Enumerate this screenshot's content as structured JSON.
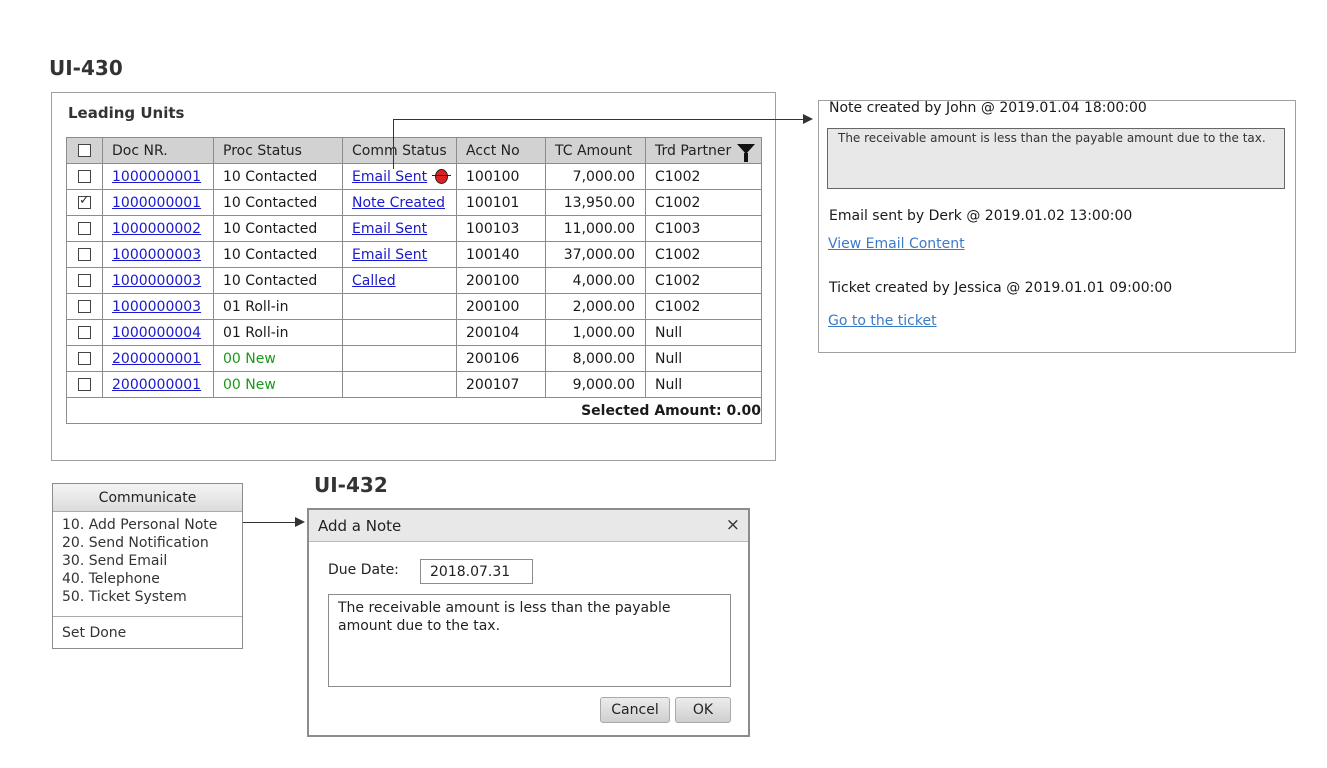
{
  "ui430": {
    "id_label": "UI-430",
    "panel_title": "Leading Units"
  },
  "table": {
    "headers": [
      "Doc NR.",
      "Proc Status",
      "Comm Status",
      "Acct No",
      "TC Amount",
      "Trd Partner"
    ],
    "rows": [
      {
        "checked": false,
        "doc": "1000000001",
        "proc": "10 Contacted",
        "comm": "Email Sent",
        "acct": "100100",
        "amount": "7,000.00",
        "partner": "C1002",
        "proc_color": "#1a1a1a",
        "flag": "bug-icon"
      },
      {
        "checked": true,
        "doc": "1000000001",
        "proc": "10 Contacted",
        "comm": "Note Created",
        "acct": "100101",
        "amount": "13,950.00",
        "partner": "C1002",
        "proc_color": "#1a1a1a"
      },
      {
        "checked": false,
        "doc": "1000000002",
        "proc": "10 Contacted",
        "comm": "Email Sent",
        "acct": "100103",
        "amount": "11,000.00",
        "partner": "C1003",
        "proc_color": "#1a1a1a"
      },
      {
        "checked": false,
        "doc": "1000000003",
        "proc": "10 Contacted",
        "comm": "Email Sent",
        "acct": "100140",
        "amount": "37,000.00",
        "partner": "C1002",
        "proc_color": "#1a1a1a"
      },
      {
        "checked": false,
        "doc": "1000000003",
        "proc": "10 Contacted",
        "comm": "Called",
        "acct": "200100",
        "amount": "4,000.00",
        "partner": "C1002",
        "proc_color": "#1a1a1a"
      },
      {
        "checked": false,
        "doc": "1000000003",
        "proc": "01 Roll-in",
        "comm": "",
        "acct": "200100",
        "amount": "2,000.00",
        "partner": "C1002",
        "proc_color": "#1a1a1a"
      },
      {
        "checked": false,
        "doc": "1000000004",
        "proc": "01 Roll-in",
        "comm": "",
        "acct": "200104",
        "amount": "1,000.00",
        "partner": "Null",
        "proc_color": "#1a1a1a"
      },
      {
        "checked": false,
        "doc": "2000000001",
        "proc": "00 New",
        "comm": "",
        "acct": "200106",
        "amount": "8,000.00",
        "partner": "Null",
        "proc_color": "#1a9a1a"
      },
      {
        "checked": false,
        "doc": "2000000001",
        "proc": "00 New",
        "comm": "",
        "acct": "200107",
        "amount": "9,000.00",
        "partner": "Null",
        "proc_color": "#1a9a1a"
      }
    ],
    "selected_amount": "Selected Amount: 0.00"
  },
  "notes": {
    "note_header": "Note created by John @ 2019.01.04 18:00:00",
    "note_text": "The receivable amount is less than the payable amount due to the tax.",
    "email_header": "Email sent by Derk @ 2019.01.02 13:00:00",
    "email_link": "View Email Content",
    "ticket_header": "Ticket created by Jessica @ 2019.01.01 09:00:00",
    "ticket_link": "Go to the ticket"
  },
  "communicate": {
    "button_label": "Communicate",
    "items": [
      "10. Add Personal Note",
      "20. Send Notification",
      "30. Send Email",
      "40. Telephone",
      "50. Ticket System"
    ],
    "done_label": "Set Done"
  },
  "ui432": {
    "id_label": "UI-432",
    "dialog_title": "Add a Note",
    "close_glyph": "×",
    "due_date_label": "Due Date:",
    "due_date_value": "2018.07.31",
    "note_value": "The receivable amount is less than the payable amount due to the tax.",
    "cancel_label": "Cancel",
    "ok_label": "OK"
  }
}
